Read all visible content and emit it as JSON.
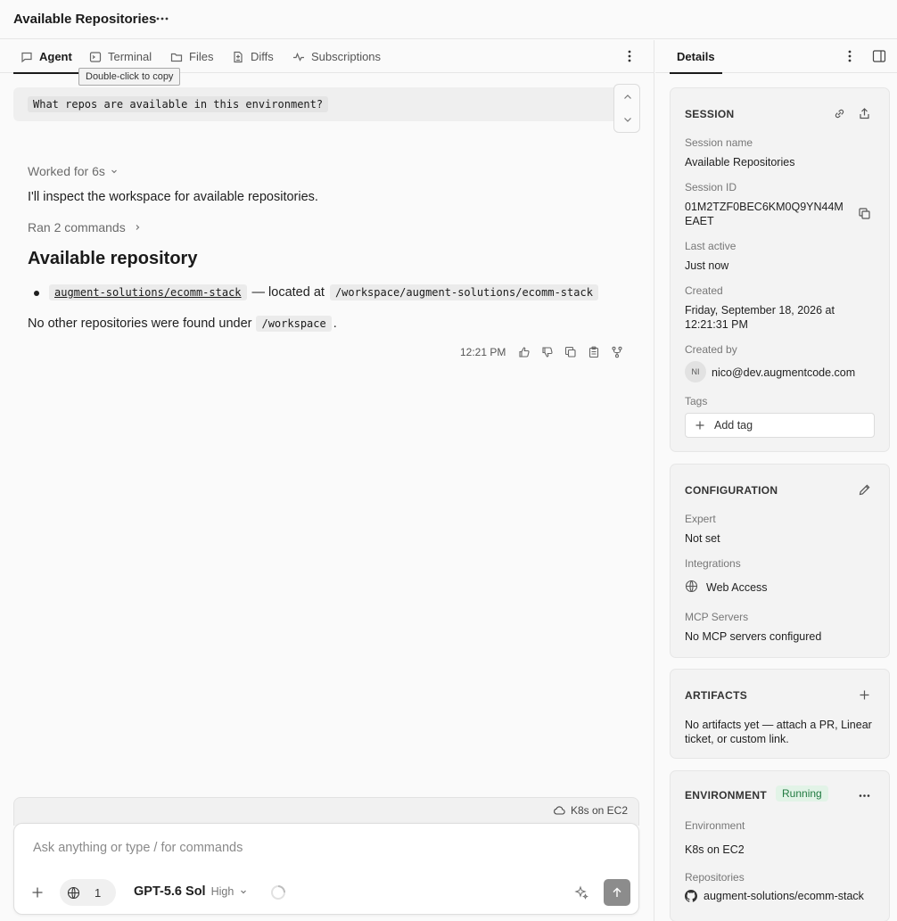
{
  "header": {
    "title": "Available Repositories"
  },
  "tabs": [
    {
      "label": "Agent",
      "icon": "chat-bubble-icon"
    },
    {
      "label": "Terminal",
      "icon": "terminal-icon"
    },
    {
      "label": "Files",
      "icon": "folder-icon"
    },
    {
      "label": "Diffs",
      "icon": "diff-file-icon"
    },
    {
      "label": "Subscriptions",
      "icon": "pulse-icon"
    }
  ],
  "tooltip": "Double-click to copy",
  "conversation": {
    "user_message": "What repos are available in this environment?",
    "worked_for": "Worked for 6s",
    "intro": "I'll inspect the workspace for available repositories.",
    "ran_commands": "Ran 2 commands",
    "heading": "Available repository",
    "repo_name": "augment-solutions/ecomm-stack",
    "located_text": "— located at",
    "repo_path": "/workspace/augment-solutions/ecomm-stack",
    "footer_before": "No other repositories were found under",
    "footer_path": "/workspace",
    "footer_after": ".",
    "time": "12:21 PM"
  },
  "composer": {
    "env_label": "K8s on EC2",
    "placeholder": "Ask anything or type / for commands",
    "tool_count": "1",
    "model": "GPT-5.6 Sol",
    "level": "High"
  },
  "details": {
    "tab": "Details",
    "session": {
      "header": "SESSION",
      "name_label": "Session name",
      "name": "Available Repositories",
      "id_label": "Session ID",
      "id_line1": "01M2TZF0BEC6KM0Q9YN44M",
      "id_line2": "EAET",
      "last_active_label": "Last active",
      "last_active": "Just now",
      "created_label": "Created",
      "created_line1": "Friday, September 18, 2026 at",
      "created_line2": "12:21:31 PM",
      "created_by_label": "Created by",
      "avatar_initials": "NI",
      "created_by": "nico@dev.augmentcode.com",
      "tags_label": "Tags",
      "add_tag": "Add tag"
    },
    "configuration": {
      "header": "CONFIGURATION",
      "expert_label": "Expert",
      "expert": "Not set",
      "integrations_label": "Integrations",
      "integration": "Web Access",
      "mcp_label": "MCP Servers",
      "mcp": "No MCP servers configured"
    },
    "artifacts": {
      "header": "ARTIFACTS",
      "empty_line1": "No artifacts yet — attach a PR, Linear",
      "empty_line2": "ticket, or custom link."
    },
    "environment": {
      "header": "ENVIRONMENT",
      "status": "Running",
      "env_label": "Environment",
      "env": "K8s on EC2",
      "repos_label": "Repositories",
      "repo": "augment-solutions/ecomm-stack"
    }
  },
  "colors": {
    "running_badge_bg": "#e2f3e7",
    "running_badge_text": "#217a41",
    "send_button": "#8c8c8c"
  }
}
